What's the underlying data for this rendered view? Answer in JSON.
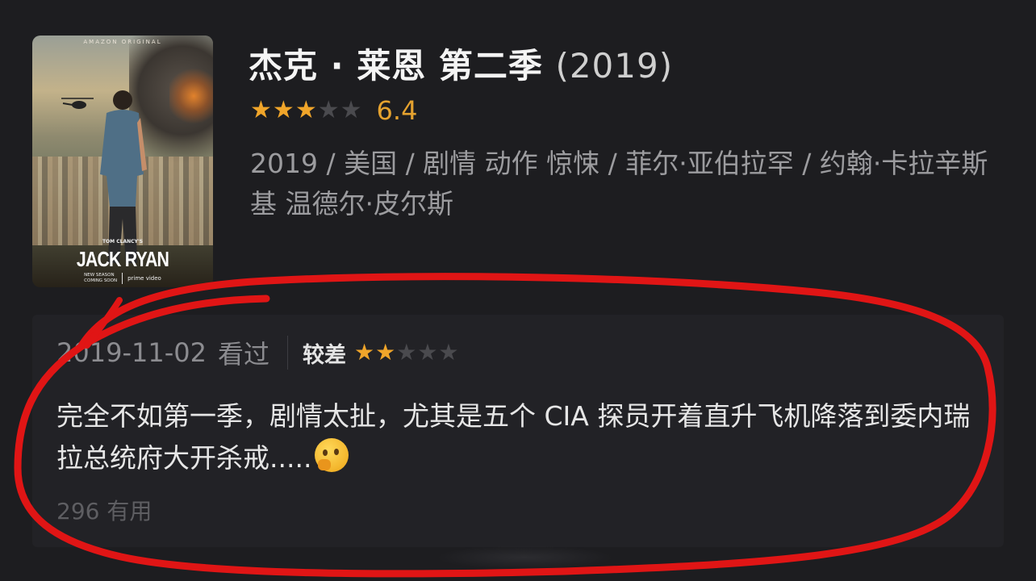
{
  "poster": {
    "studio_tag": "AMAZON ORIGINAL",
    "series_prefix": "TOM CLANCY'S",
    "series_name": "JACK RYAN",
    "season_line1": "NEW SEASON",
    "season_line2": "COMING SOON",
    "platform": "prime video"
  },
  "show": {
    "title": "杰克 · 莱恩 第二季",
    "year": "(2019)",
    "rating_stars": 3,
    "max_stars": 5,
    "score": "6.4",
    "meta_text": "2019 / 美国 / 剧情 动作 惊悚 / 菲尔·亚伯拉罕 / 约翰·卡拉辛斯基 温德尔·皮尔斯"
  },
  "review": {
    "date": "2019-11-02",
    "status": "看过",
    "level": "较差",
    "stars": 2,
    "max_stars": 5,
    "content": "完全不如第一季，剧情太扯，尤其是五个 CIA 探员开着直升飞机降落到委内瑞拉总统府大开杀戒.....",
    "emoji": "thinking-face",
    "helpful": "296 有用"
  },
  "colors": {
    "background": "#1d1d20",
    "star_on": "#f0a52a",
    "star_off": "#4a4a4e",
    "score": "#e5a22f",
    "annotation": "#e01515"
  }
}
